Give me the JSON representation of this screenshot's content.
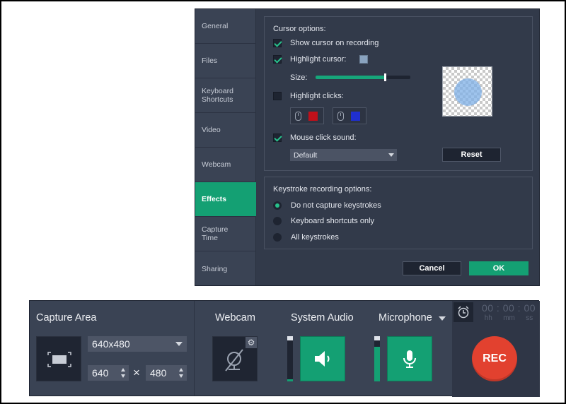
{
  "sidebar": {
    "items": [
      {
        "label": "General"
      },
      {
        "label": "Files"
      },
      {
        "label": "Keyboard Shortcuts"
      },
      {
        "label": "Video"
      },
      {
        "label": "Webcam"
      },
      {
        "label": "Effects",
        "active": true
      },
      {
        "label": "Capture Time"
      },
      {
        "label": "Sharing"
      }
    ]
  },
  "cursor": {
    "title": "Cursor options:",
    "show_cursor": {
      "label": "Show cursor on recording",
      "checked": true
    },
    "highlight_cursor": {
      "label": "Highlight cursor:",
      "checked": true,
      "color": "#8aa3bf"
    },
    "size_label": "Size:",
    "size_level": 0.73,
    "highlight_clicks": {
      "label": "Highlight clicks:",
      "checked": false,
      "left_color": "#c0101a",
      "right_color": "#1f2fd0"
    },
    "click_sound": {
      "label": "Mouse click sound:",
      "checked": true
    },
    "sound_select": {
      "value": "Default"
    },
    "reset_label": "Reset"
  },
  "keystroke": {
    "title": "Keystroke recording options:",
    "options": [
      {
        "label": "Do not capture keystrokes",
        "selected": true
      },
      {
        "label": "Keyboard shortcuts only",
        "selected": false
      },
      {
        "label": "All keystrokes",
        "selected": false
      }
    ]
  },
  "dialog_buttons": {
    "cancel": "Cancel",
    "ok": "OK"
  },
  "toolbar": {
    "capture_area": {
      "title": "Capture Area",
      "preset": "640x480",
      "width": "640",
      "times": "×",
      "height": "480"
    },
    "webcam": {
      "title": "Webcam"
    },
    "system_audio": {
      "title": "System Audio",
      "level": 0.05
    },
    "microphone": {
      "title": "Microphone",
      "level": 0.85
    },
    "timer": {
      "digits": "00 : 00 : 00",
      "units": [
        "hh",
        "mm",
        "ss"
      ]
    },
    "rec_label": "REC"
  },
  "colors": {
    "accent": "#14a073",
    "rec": "#e2412f",
    "panel": "#323a4a"
  }
}
